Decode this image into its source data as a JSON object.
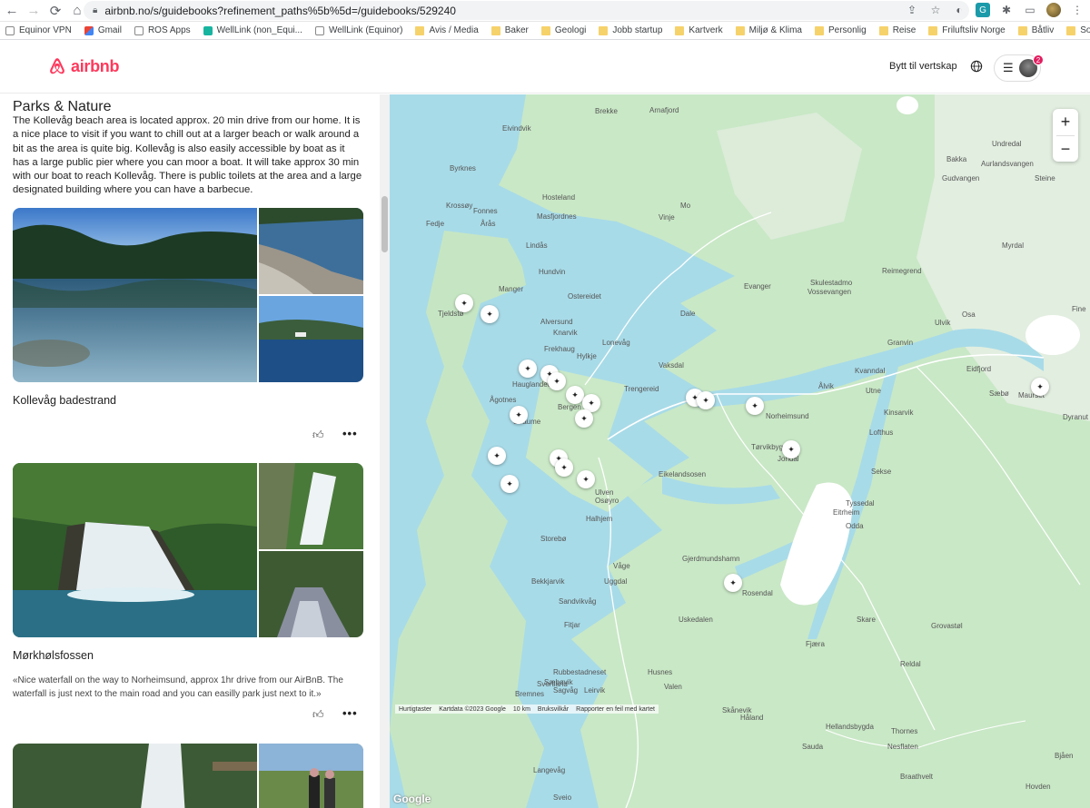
{
  "browser": {
    "url": "airbnb.no/s/guidebooks?refinement_paths%5b%5d=/guidebooks/529240",
    "bookmarks": [
      {
        "label": "Equinor VPN",
        "icon": "page"
      },
      {
        "label": "Gmail",
        "icon": "gmail"
      },
      {
        "label": "ROS Apps",
        "icon": "page"
      },
      {
        "label": "WellLink (non_Equi...",
        "icon": "wl"
      },
      {
        "label": "WellLink (Equinor)",
        "icon": "page"
      },
      {
        "label": "Avis / Media",
        "icon": "folder"
      },
      {
        "label": "Baker",
        "icon": "folder"
      },
      {
        "label": "Geologi",
        "icon": "folder"
      },
      {
        "label": "Jobb startup",
        "icon": "folder"
      },
      {
        "label": "Kartverk",
        "icon": "folder"
      },
      {
        "label": "Miljø & Klima",
        "icon": "folder"
      },
      {
        "label": "Personlig",
        "icon": "folder"
      },
      {
        "label": "Reise",
        "icon": "folder"
      },
      {
        "label": "Friluftsliv Norge",
        "icon": "folder"
      },
      {
        "label": "Båtliv",
        "icon": "folder"
      },
      {
        "label": "Solceller på tak",
        "icon": "folder"
      }
    ]
  },
  "header": {
    "logo_text": "airbnb",
    "host_link": "Bytt til vertskap",
    "notification_count": "2"
  },
  "guide": {
    "section_title": "Parks & Nature",
    "section_description": "The Kollevåg beach area is located approx. 20 min drive from our home. It is a nice place to visit if you want to chill out at a larger beach or walk around a bit as the area is quite big. Kollevåg is also easily accessible by boat as it has a large public pier where you can moor a boat. It will take approx 30 min with our boat to reach Kollevåg. There is public toilets at the area and a large designated building where you can have a barbecue.",
    "places": [
      {
        "name": "Kollevåg badestrand",
        "quote": ""
      },
      {
        "name": "Mørkhølsfossen",
        "quote": "«Nice waterfall on the way to Norheimsund, approx 1hr drive from our AirBnB. The waterfall is just next to the main road and you can easilly park just next to it.»"
      }
    ],
    "more_label": "•••"
  },
  "map": {
    "zoom_in": "+",
    "zoom_out": "−",
    "place_labels": [
      "Brekke",
      "Arnafjord",
      "Eivindvik",
      "Undredal",
      "Byrknes",
      "Bakka",
      "Aurlandsvangen",
      "Gudvangen",
      "Steine",
      "Krossøy",
      "Hosteland",
      "Mo",
      "Fedje",
      "Fonnes",
      "Årås",
      "Masfjordnes",
      "Vinje",
      "Myrdal",
      "Lindås",
      "Hundvin",
      "Reimegrend",
      "Skulestadmo",
      "Vossevangen",
      "Manger",
      "Evanger",
      "Tjeldstø",
      "Ostereidet",
      "Dale",
      "Osa",
      "Ulvik",
      "Alversund",
      "Knarvik",
      "Fine",
      "Frekhaug",
      "Lonevåg",
      "Hylkje",
      "Granvin",
      "Hauglandet",
      "Vaksdal",
      "Kvanndal",
      "Eidfjord",
      "Ågotnes",
      "Bergen",
      "Trengereid",
      "Ålvik",
      "Utne",
      "Sæbø",
      "Maurset",
      "Straume",
      "Norheimsund",
      "Kinsarvik",
      "Dyranut",
      "Lofthus",
      "Tørvikbygd",
      "Jondal",
      "Sekse",
      "Eikelandsosen",
      "Ulven",
      "Osøyro",
      "Halhjem",
      "Tyssedal",
      "Eitrheim",
      "Odda",
      "Storebø",
      "Våge",
      "Gjerdmundshamn",
      "Bekkjarvik",
      "Uggdal",
      "Rosendal",
      "Sandvikvåg",
      "Fitjar",
      "Uskedalen",
      "Skare",
      "Grovastøl",
      "Fjæra",
      "Rubbestadneset",
      "Husnes",
      "Sæbøvik",
      "Reldal",
      "Sagvåg",
      "Leirvik",
      "Valen",
      "Bremnes",
      "Svortland",
      "Skånevik",
      "Håland",
      "Hellandsbygda",
      "Thornes",
      "Nesflaten",
      "Sauda",
      "Langevåg",
      "Braathvelt",
      "Sveio",
      "Hovden",
      "Bjåen"
    ],
    "footer": [
      "Hurtigtaster",
      "Kartdata ©2023 Google",
      "10 km",
      "Bruksvilkår",
      "Rapporter en feil med kartet"
    ],
    "google_label": "Google"
  },
  "colors": {
    "brand": "#ff385c",
    "water": "#a8dbe8",
    "land": "#c9e8c6",
    "badge": "#e31c5f"
  }
}
